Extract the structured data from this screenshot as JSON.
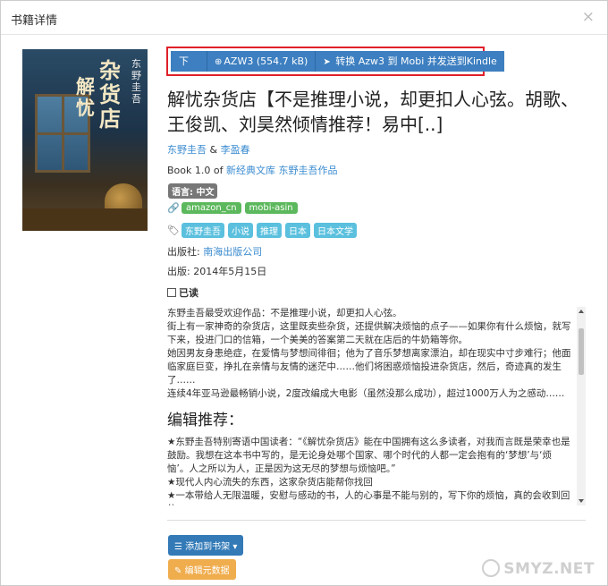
{
  "modal": {
    "title": "书籍详情",
    "close_glyph": "×"
  },
  "cover": {
    "title_main": "解忧",
    "title_sub": "杂货店",
    "author": "东野圭吾"
  },
  "download": {
    "label": "下载：",
    "format_button": "AZW3 (554.7 kB)",
    "convert_button": "转换 Azw3 到 Mobi 并发送到Kindle",
    "format_icon": "download-icon",
    "convert_icon": "send-icon"
  },
  "book": {
    "title": "解忧杂货店【不是推理小说，却更扣人心弦。胡歌、王俊凯、刘昊然倾情推荐！易中[..]",
    "author1": "东野圭吾",
    "author_sep": " & ",
    "author2": "李盈春",
    "series_prefix": "Book 1.0 of ",
    "series1": "新经典文库",
    "series2": "东野圭吾作品",
    "language": "语言: 中文",
    "identifiers": [
      "amazon_cn",
      "mobi-asin"
    ],
    "tags": [
      "东野圭吾",
      "小说",
      "推理",
      "日本",
      "日本文学"
    ],
    "publisher_label": "出版社: ",
    "publisher": "南海出版公司",
    "pubdate": "出版: 2014年5月15日",
    "read_label": "已读"
  },
  "description": {
    "p1": "东野圭吾最受欢迎作品：不是推理小说，却更扣人心弦。",
    "p2": "街上有一家神奇的杂货店，这里既卖些杂货，还提供解决烦恼的点子——如果你有什么烦恼，就写下来，投进门口的信箱，一个美美的答案第二天就在店后的牛奶箱等你。",
    "p3": "她因男友身患绝症，在爱情与梦想间徘徊；他为了音乐梦想离家漂泊，却在现实中寸步难行；他面临家庭巨变，挣扎在亲情与友情的迷茫中……他们将困惑烦恼投进杂货店，然后，奇迹真的发生了……",
    "p4": "连续4年亚马逊最畅销小说，2度改编成大电影（虽然没那么成功），超过1000万人为之感动……",
    "heading": "编辑推荐：",
    "p5": "★东野圭吾特别寄语中国读者：“《解忧杂货店》能在中国拥有这么多读者，对我而言既是荣幸也是鼓励。我想在这本书中写的，是无论身处哪个国家、哪个时代的人都一定会抱有的‘梦想’与‘烦恼’。人之所以为人，正是因为这无尽的梦想与烦恼吧。”",
    "p6": "★现代人内心流失的东西，这家杂货店能帮你找回",
    "p7": "★一本带给人无限温暖，安慰与感动的书，人的心事是不能与别的，写下你的烦恼，真的会收到回信。"
  },
  "actions": {
    "add_shelf": "添加到书架",
    "edit_meta": "编辑元数据"
  },
  "watermark": "SMYZ.NET",
  "colors": {
    "primary": "#337ab7",
    "link": "#3a8bd0",
    "success": "#5cb85c",
    "info": "#5bc0de",
    "warning": "#f0ad4e",
    "highlight": "#e0202a"
  }
}
